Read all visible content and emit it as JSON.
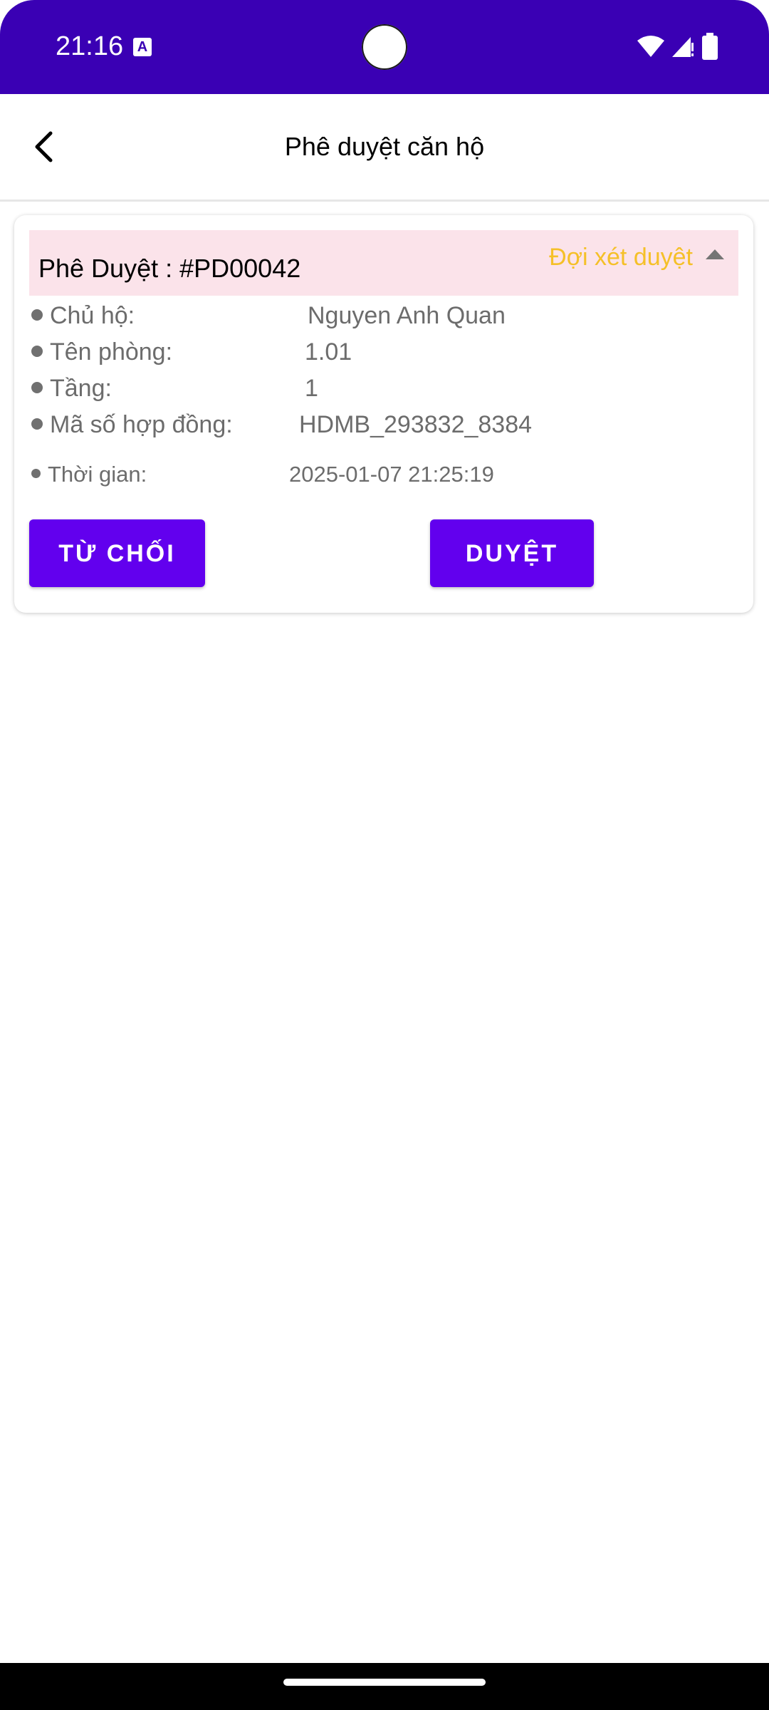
{
  "status_bar": {
    "time": "21:16",
    "a_icon": "A"
  },
  "app_bar": {
    "title": "Phê duyệt căn hộ",
    "back_icon": "chevron-left-icon"
  },
  "card": {
    "title": "Phê Duyệt : #PD00042",
    "status": "Đợi xét duyệt",
    "status_color": "#f5c028",
    "header_bg": "#fbe3ea",
    "details": [
      {
        "label": "Chủ hộ:",
        "value": "Nguyen Anh Quan"
      },
      {
        "label": "Tên phòng:",
        "value": "1.01"
      },
      {
        "label": "Tầng:",
        "value": "1"
      },
      {
        "label": "Mã số hợp đồng:",
        "value": "HDMB_293832_8384"
      },
      {
        "label": "Thời gian:",
        "value": "2025-01-07 21:25:19"
      }
    ],
    "reject_label": "TỪ CHỐI",
    "approve_label": "DUYỆT",
    "button_color": "#6200ee"
  },
  "colors": {
    "status_bar": "#3a00b4",
    "nav_bar": "#000000"
  }
}
